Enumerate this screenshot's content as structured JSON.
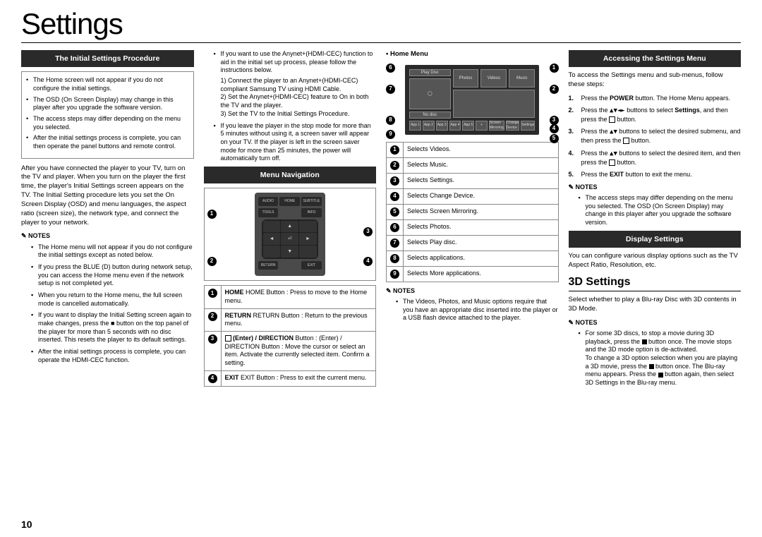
{
  "page_title": "Settings",
  "page_number": "10",
  "col1": {
    "h1": "The Initial Settings Procedure",
    "box": [
      "The Home screen will not appear if you do not configure the initial settings.",
      "The OSD (On Screen Display) may change in this player after you upgrade the software version.",
      "The access steps may differ depending on the menu you selected.",
      "After the initial settings process is complete, you can then operate the panel buttons and remote control."
    ],
    "p1": "After you have connected the player to your TV, turn on the TV and player. When you turn on the player the first time, the player's Initial Settings screen appears on the TV. The Initial Setting procedure lets you set the On Screen Display (OSD) and menu languages, the aspect ratio (screen size), the network type, and connect the player to your network.",
    "notes_label": "NOTES",
    "notes": [
      "The Home menu will not appear if you do not configure the initial settings except as noted below.",
      "If you press the BLUE (D) button during network setup, you can access the Home menu even if the network setup is not completed yet.",
      "When you return to the Home menu, the full screen mode is cancelled automatically.",
      "If you want to display the Initial Setting screen again to make changes, press the ■ button on the top panel of the player for more than 5 seconds with no disc inserted. This resets the player to its default settings.",
      "After the initial settings process is complete, you can operate the HDMI-CEC function."
    ]
  },
  "col2": {
    "bullets": [
      "If you want to use the Anynet+(HDMI-CEC) function to aid in the initial set up process, please follow the instructions below.",
      "If you leave the player in the stop mode for more than 5 minutes without using it, a screen saver will appear on your TV. If the player is left in the screen saver mode for more than 25 minutes, the power will automatically turn off."
    ],
    "sub1": "1) Connect the player to an Anynet+(HDMI-CEC) compliant Samsung TV using HDMI Cable.",
    "sub2": "2) Set the Anynet+(HDMI-CEC) feature to On in both the TV and the player.",
    "sub3": "3) Set the TV to the Initial Settings Procedure.",
    "h2": "Menu Navigation",
    "remote_labels": {
      "audio": "AUDIO",
      "home": "HOME",
      "subtitle": "SUBTITLE",
      "tools": "TOOLS",
      "info": "INFO",
      "return": "RETURN",
      "exit": "EXIT"
    },
    "legend": [
      "HOME Button : Press to move to the Home menu.",
      "RETURN Button : Return to the previous menu.",
      "(Enter) / DIRECTION Button : Move the cursor or select an item. Activate the currently selected item. Confirm a setting.",
      "EXIT Button : Press to exit the current menu."
    ]
  },
  "col3": {
    "home_menu_label": "• Home Menu",
    "tiles": {
      "play": "Play Disc",
      "nodisc": "No disc",
      "photos": "Photos",
      "videos": "Videos",
      "music": "Music",
      "app1": "App 1",
      "app2": "App 2",
      "app3": "App 3",
      "app4": "App 4",
      "app5": "App 5",
      "more": "+",
      "mirror": "Screen Mirroring",
      "change": "Change Device",
      "settings": "Settings"
    },
    "legend": [
      "Selects Videos.",
      "Selects Music.",
      "Selects Settings.",
      "Selects Change Device.",
      "Selects Screen Mirroring.",
      "Selects Photos.",
      "Selects Play disc.",
      "Selects applications.",
      "Selects More applications."
    ],
    "notes_label": "NOTES",
    "notes": [
      "The Videos, Photos, and Music options require that you have an appropriate disc inserted into the player or a USB flash device attached to the player."
    ]
  },
  "col4": {
    "h1": "Accessing the Settings Menu",
    "p1": "To access the Settings menu and sub-menus, follow these steps:",
    "steps": [
      "Press the POWER button. The Home Menu appears.",
      "Press the ▲▼◄► buttons to select Settings, and then press the ⏎ button.",
      "Press the ▲▼ buttons to select the desired submenu, and then press the ⏎ button.",
      "Press the ▲▼ buttons to select the desired item, and then press the ⏎ button.",
      "Press the EXIT button to exit the menu."
    ],
    "notes_label": "NOTES",
    "notes1": [
      "The access steps may differ depending on the menu you selected. The OSD (On Screen Display) may change in this player after you upgrade the software version."
    ],
    "h2": "Display Settings",
    "p2": "You can configure various display options such as the TV Aspect Ratio, Resolution, etc.",
    "h3": "3D Settings",
    "p3": "Select whether to play a Blu-ray Disc with 3D contents in 3D Mode.",
    "notes2": [
      "For some 3D discs, to stop a movie during 3D playback, press the ■ button once. The movie stops and the 3D mode option is de-activated. To change a 3D option selection when you are playing a 3D movie, press the ■ button once. The Blu-ray menu appears. Press the ■ button again, then select 3D Settings in the Blu-ray menu."
    ]
  }
}
